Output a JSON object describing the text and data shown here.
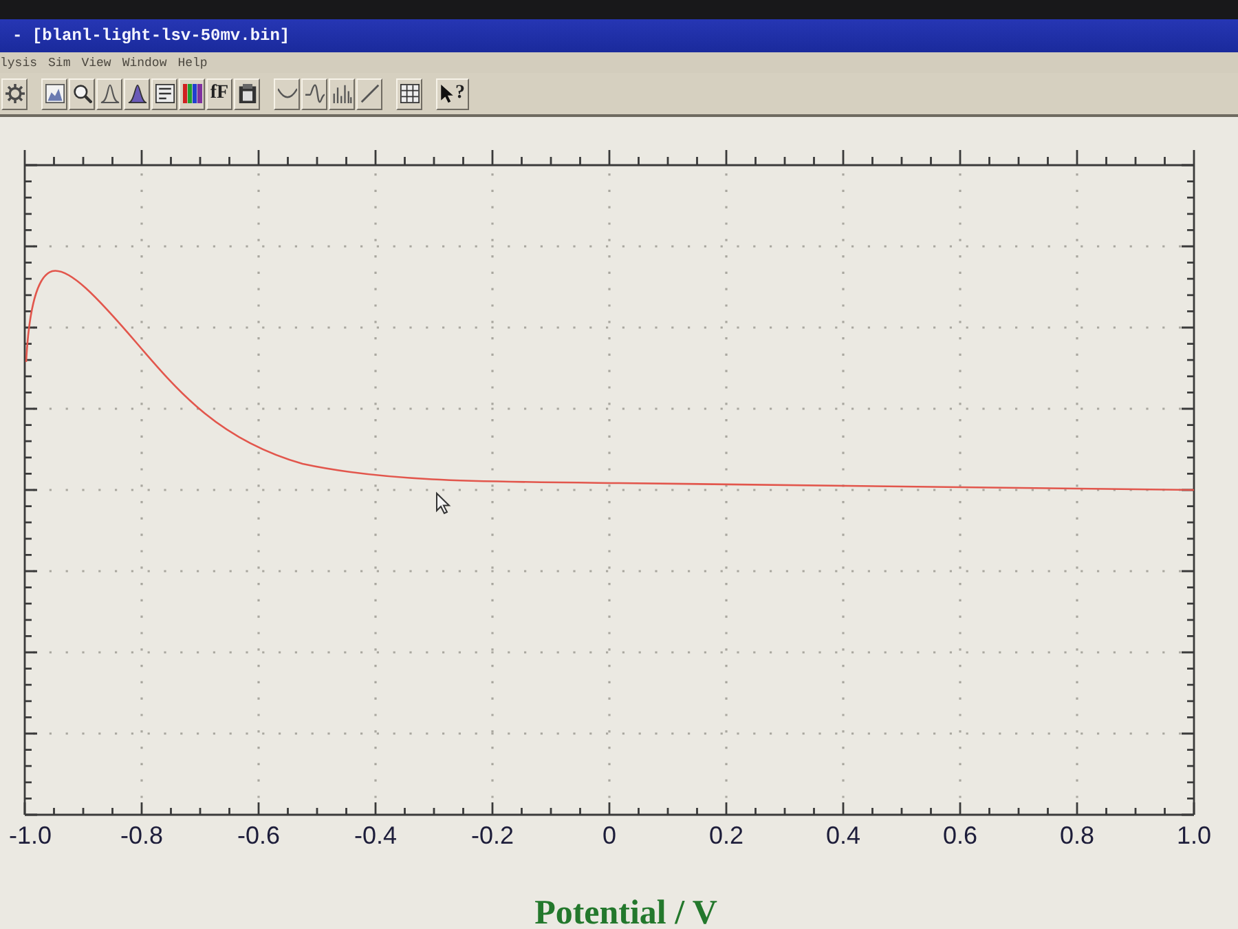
{
  "window": {
    "title": "- [blanl-light-lsv-50mv.bin]"
  },
  "menu": [
    "lysis",
    "Sim",
    "View",
    "Window",
    "Help"
  ],
  "toolbar": [
    {
      "kind": "gear"
    },
    {
      "kind": "separator"
    },
    {
      "kind": "graph"
    },
    {
      "kind": "zoom"
    },
    {
      "kind": "peak"
    },
    {
      "kind": "peaks"
    },
    {
      "kind": "panel"
    },
    {
      "kind": "colors"
    },
    {
      "kind": "font",
      "label": "fF"
    },
    {
      "kind": "clipboard"
    },
    {
      "kind": "separator"
    },
    {
      "kind": "smooth"
    },
    {
      "kind": "wave"
    },
    {
      "kind": "derivative"
    },
    {
      "kind": "slope"
    },
    {
      "kind": "separator"
    },
    {
      "kind": "grid"
    },
    {
      "kind": "separator"
    },
    {
      "kind": "help",
      "label": "?"
    }
  ],
  "plot": {
    "x_axis": {
      "title": "Potential / V",
      "tick_labels": [
        "-1.0",
        "-0.8",
        "-0.6",
        "-0.4",
        "-0.2",
        "0",
        "0.2",
        "0.4",
        "0.6",
        "0.8",
        "1.0"
      ]
    }
  }
}
